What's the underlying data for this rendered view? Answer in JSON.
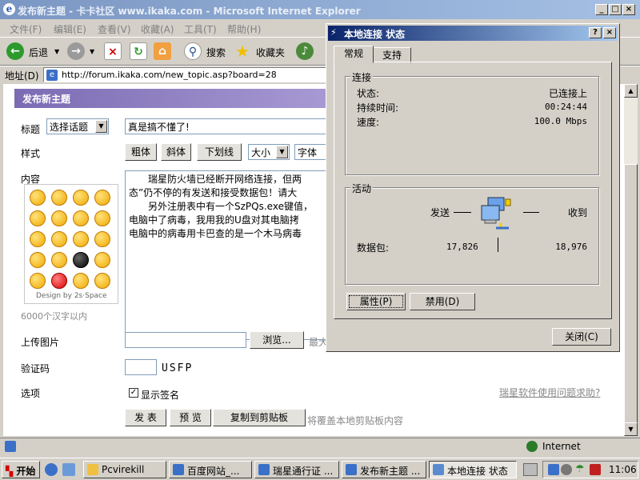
{
  "ie": {
    "title": "发布新主题 - 卡卡社区 www.ikaka.com - Microsoft Internet Explorer",
    "menu": [
      "文件(F)",
      "编辑(E)",
      "查看(V)",
      "收藏(A)",
      "工具(T)",
      "帮助(H)"
    ],
    "toolbar": {
      "back": "后退",
      "search": "搜索",
      "favorites": "收藏夹"
    },
    "address_label": "地址(D)",
    "address_value": "http://forum.ikaka.com/new_topic.asp?board=28",
    "status_zone": "Internet"
  },
  "form": {
    "header": "发布新主题",
    "title_label": "标题",
    "topic_select": "选择话题",
    "title_value": "真是搞不懂了!",
    "style_label": "样式",
    "style_buttons": [
      "粗体",
      "斜体",
      "下划线"
    ],
    "size_select": "大小",
    "font_select": "字体",
    "content_label": "内容",
    "content_lines": [
      "　　瑞星防火墙已经断开网络连接，但两",
      "态”仍不停的有发送和接受数据包！请大",
      "　　另外注册表中有一个SzPQs.exe键值，",
      "电脑中了病毒，我用我的U盘对其电脑拷",
      "电脑中的病毒用卡巴查的是一个木马病毒"
    ],
    "smiley_credit": "Design by 2s·Space",
    "char_limit": "6000个汉字以内",
    "upload_label": "上传图片",
    "browse_button": "浏览...",
    "upload_hint": "最大",
    "captcha_label": "验证码",
    "captcha_code": "USFP",
    "options_label": "选项",
    "show_signature": "显示签名",
    "help_link": "瑞星软件使用问题求助?",
    "submit_button": "发 表",
    "preview_button": "预 览",
    "copy_button": "复制到剪贴板",
    "copy_hint": "将覆盖本地剪贴板内容"
  },
  "dialog": {
    "title": "本地连接 状态",
    "tabs": [
      "常规",
      "支持"
    ],
    "connection_group": "连接",
    "status_label": "状态:",
    "status_value": "已连接上",
    "duration_label": "持续时间:",
    "duration_value": "00:24:44",
    "speed_label": "速度:",
    "speed_value": "100.0 Mbps",
    "activity_group": "活动",
    "sent_label": "发送",
    "received_label": "收到",
    "packets_label": "数据包:",
    "packets_sent": "17,826",
    "packets_received": "18,976",
    "properties_button": "属性(P)",
    "disable_button": "禁用(D)",
    "close_button": "关闭(C)"
  },
  "taskbar": {
    "start": "开始",
    "tasks": [
      "Pcvirekill",
      "百度网站_...",
      "瑞星通行证 ...",
      "发布新主题 ...",
      "本地连接 状态"
    ],
    "clock": "11:06"
  }
}
